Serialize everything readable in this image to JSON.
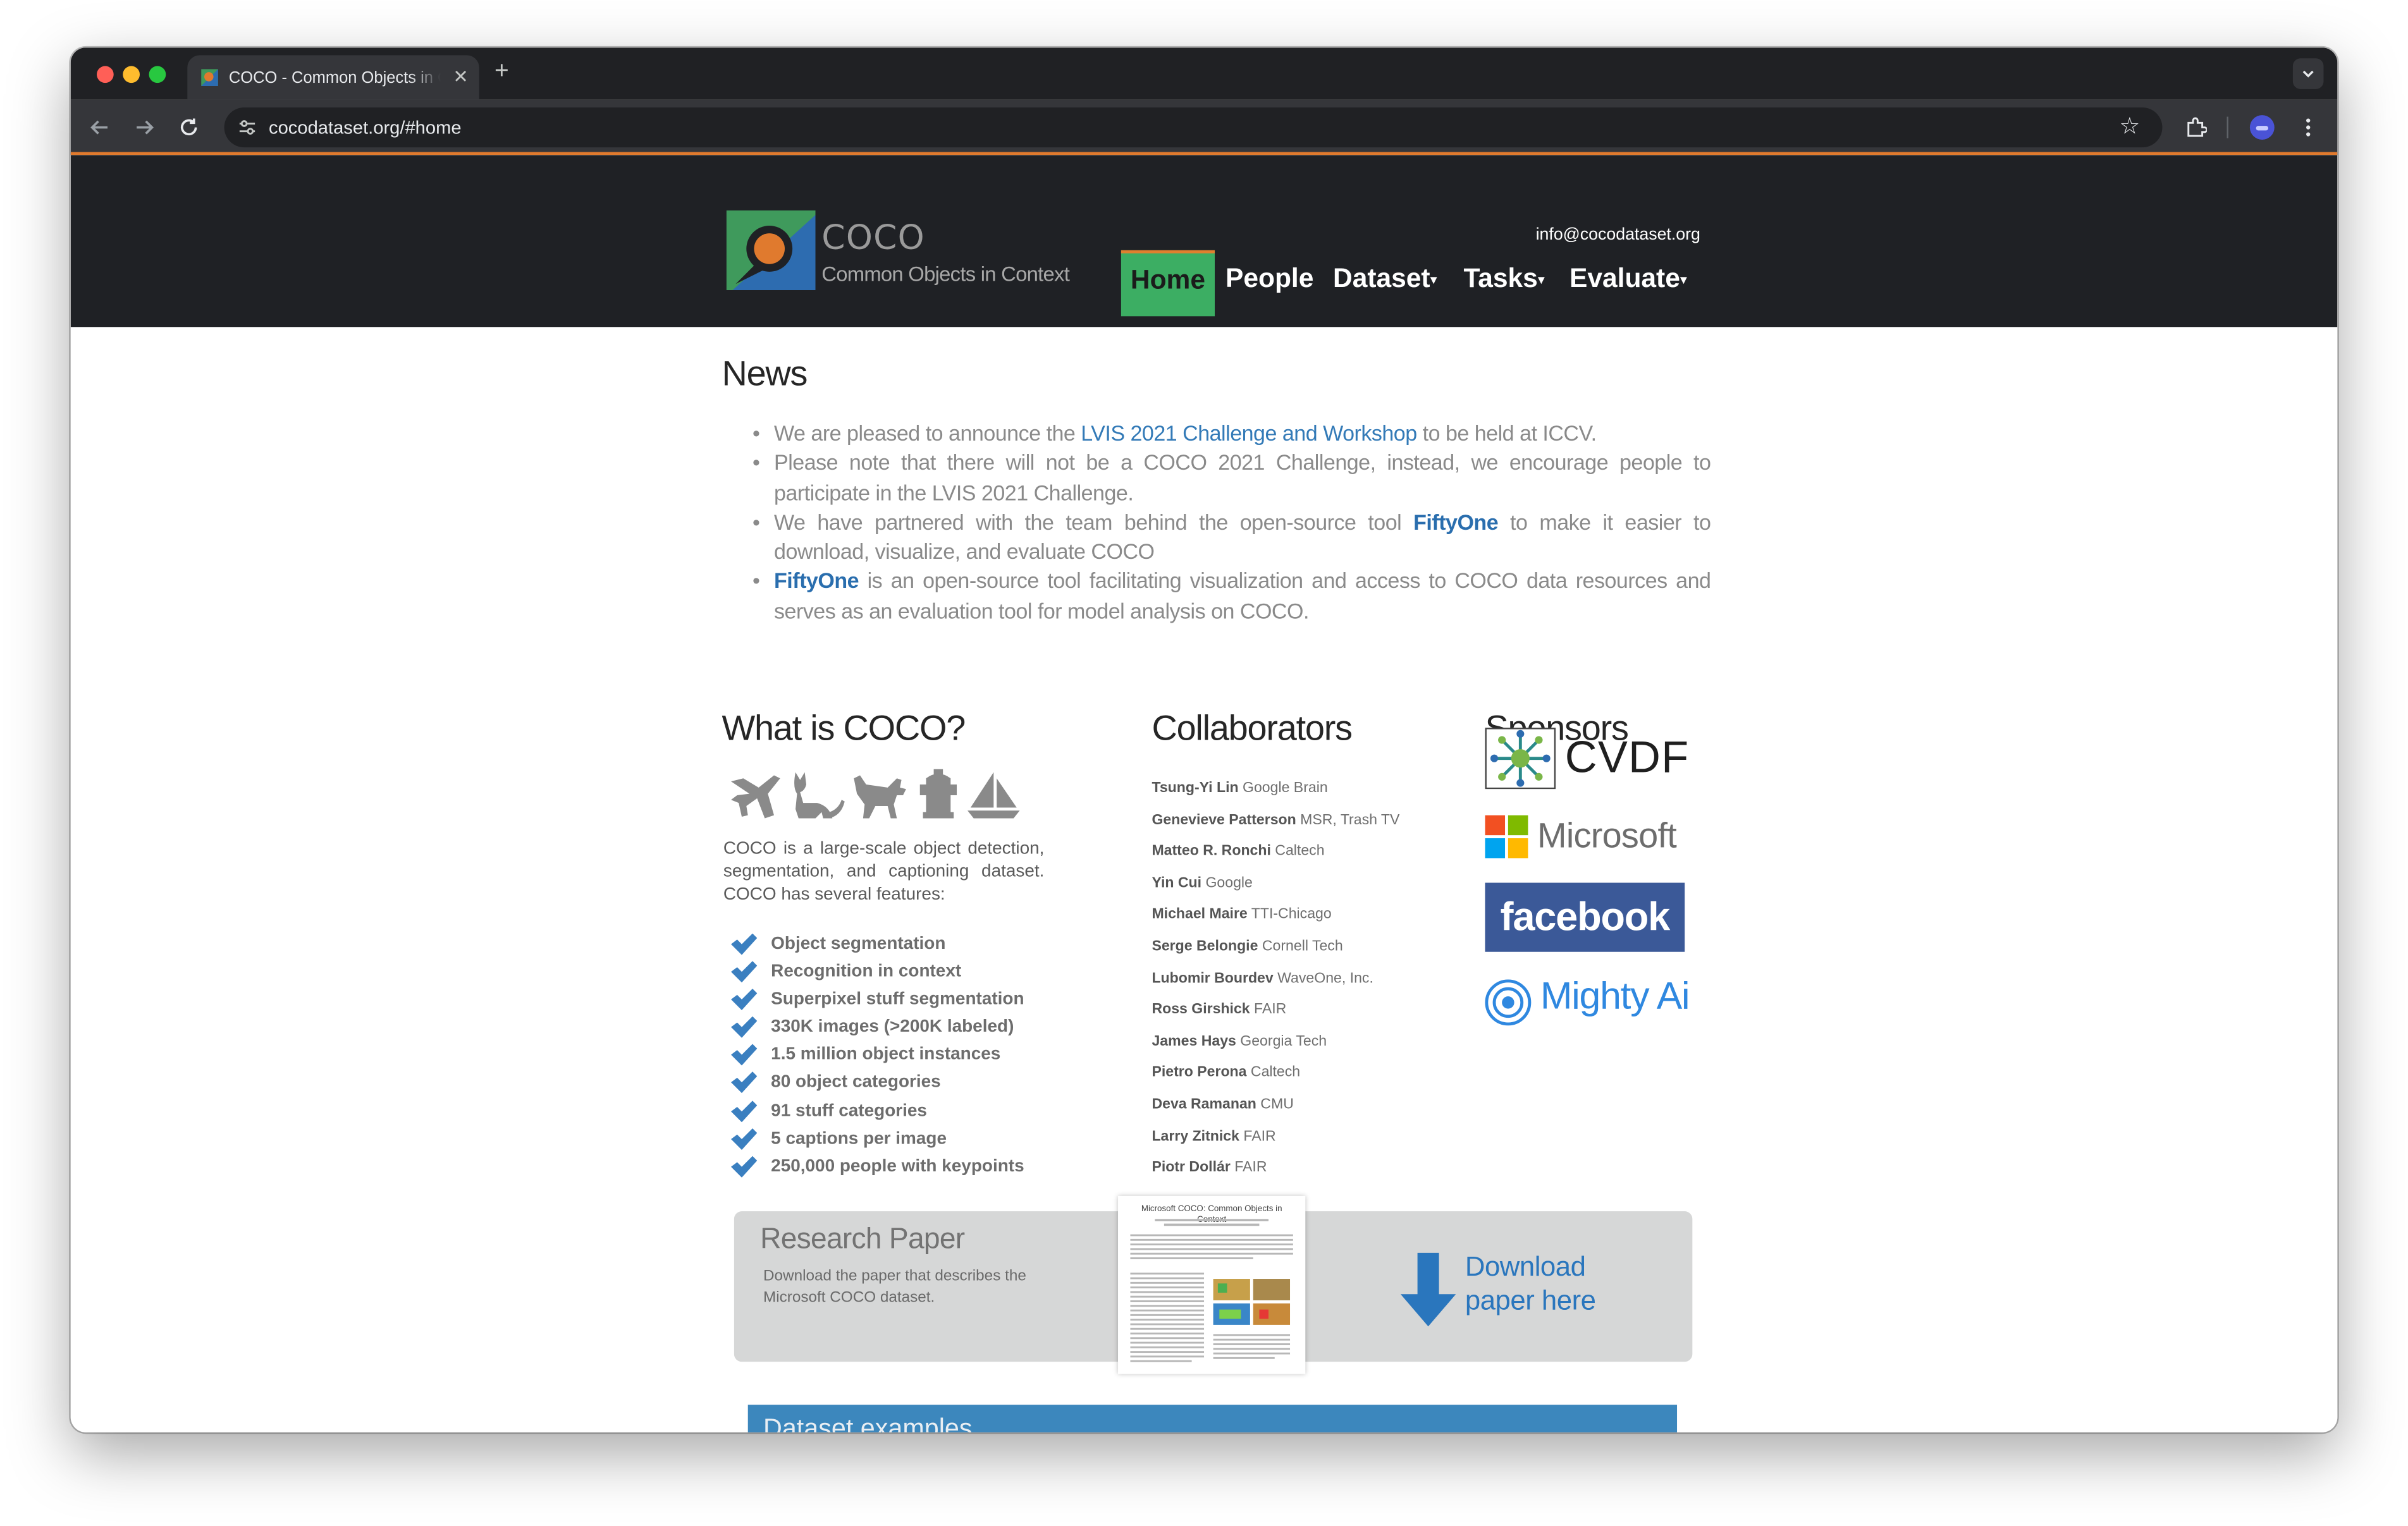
{
  "browser": {
    "tab_title": "COCO - Common Objects in Context",
    "tab_close": "✕",
    "new_tab": "+",
    "url": "cocodataset.org/#home",
    "colors": {
      "frame": "#202124",
      "toolbar": "#35363a",
      "accent": "#e07a2e"
    }
  },
  "header": {
    "logo_title": "COCO",
    "logo_subtitle": "Common Objects in Context",
    "email": "info@cocodataset.org",
    "nav": {
      "home": "Home",
      "people": "People",
      "dataset": "Dataset",
      "tasks": "Tasks",
      "evaluate": "Evaluate",
      "caret": "▾"
    },
    "colors": {
      "bar": "#1f2125",
      "home_active": "#3cae63"
    }
  },
  "news": {
    "heading": "News",
    "items": [
      {
        "pre": "We are pleased to announce the ",
        "link": "LVIS 2021 Challenge and Workshop",
        "post": " to be held at ICCV."
      },
      {
        "text": "Please note that there will not be a COCO 2021 Challenge, instead, we encourage people to participate in the LVIS 2021 Challenge."
      },
      {
        "pre": "We have partnered with the team behind the open-source tool ",
        "link": "FiftyOne",
        "post": " to make it easier to download, visualize, and evaluate COCO"
      },
      {
        "link": "FiftyOne",
        "post": " is an open-source tool facilitating visualization and access to COCO data resources and serves as an evaluation tool for model analysis on COCO."
      }
    ]
  },
  "what_is_coco": {
    "heading": "What is COCO?",
    "icons": [
      "airplane-icon",
      "cat-icon",
      "dog-icon",
      "fire-hydrant-icon",
      "sailboat-icon"
    ],
    "description": "COCO is a large-scale object detection, segmentation, and captioning dataset. COCO has several features:",
    "features": [
      "Object segmentation",
      "Recognition in context",
      "Superpixel stuff segmentation",
      "330K images (>200K labeled)",
      "1.5 million object instances",
      "80 object categories",
      "91 stuff categories",
      "5 captions per image",
      "250,000 people with keypoints"
    ]
  },
  "collaborators": {
    "heading": "Collaborators",
    "people": [
      {
        "name": "Tsung-Yi Lin",
        "org": "Google Brain"
      },
      {
        "name": "Genevieve Patterson",
        "org": "MSR, Trash TV"
      },
      {
        "name": "Matteo R. Ronchi",
        "org": "Caltech"
      },
      {
        "name": "Yin Cui",
        "org": "Google"
      },
      {
        "name": "Michael Maire",
        "org": "TTI-Chicago"
      },
      {
        "name": "Serge Belongie",
        "org": "Cornell Tech"
      },
      {
        "name": "Lubomir Bourdev",
        "org": "WaveOne, Inc."
      },
      {
        "name": "Ross Girshick",
        "org": "FAIR"
      },
      {
        "name": "James Hays",
        "org": "Georgia Tech"
      },
      {
        "name": "Pietro Perona",
        "org": "Caltech"
      },
      {
        "name": "Deva Ramanan",
        "org": "CMU"
      },
      {
        "name": "Larry Zitnick",
        "org": "FAIR"
      },
      {
        "name": "Piotr Dollár",
        "org": "FAIR"
      }
    ]
  },
  "sponsors": {
    "heading": "Sponsors",
    "cvdf": "CVDF",
    "microsoft": "Microsoft",
    "facebook": "facebook",
    "mighty_ai": "Mighty Ai"
  },
  "research_paper": {
    "title": "Research Paper",
    "subtitle": "Download the paper that describes the Microsoft COCO dataset.",
    "thumb_title": "Microsoft COCO: Common Objects in Context",
    "download_line1": "Download",
    "download_line2": "paper here"
  },
  "examples": {
    "heading": "Dataset examples"
  }
}
